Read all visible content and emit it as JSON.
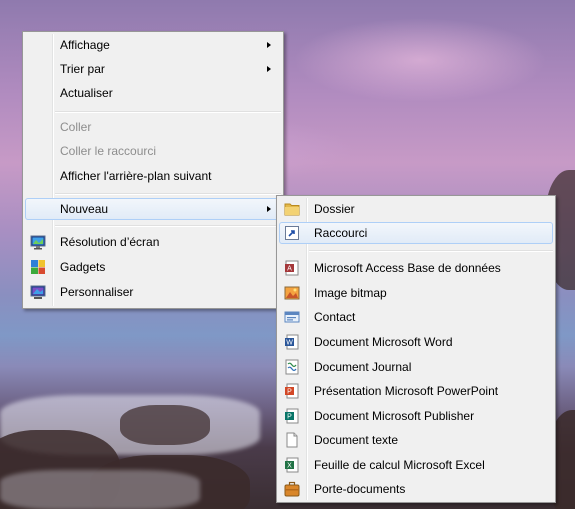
{
  "context_menu": {
    "items": [
      {
        "label": "Affichage",
        "submenu": true,
        "enabled": true
      },
      {
        "label": "Trier par",
        "submenu": true,
        "enabled": true
      },
      {
        "label": "Actualiser",
        "enabled": true
      },
      {
        "label": "Coller",
        "enabled": false
      },
      {
        "label": "Coller le raccourci",
        "enabled": false
      },
      {
        "label": "Afficher l'arrière-plan suivant",
        "enabled": true
      },
      {
        "label": "Nouveau",
        "submenu": true,
        "enabled": true,
        "highlighted": true
      },
      {
        "label": "Résolution d’écran",
        "icon": "monitor-icon"
      },
      {
        "label": "Gadgets",
        "icon": "gadgets-icon"
      },
      {
        "label": "Personnaliser",
        "icon": "personalize-icon"
      }
    ]
  },
  "new_submenu": {
    "items": [
      {
        "label": "Dossier",
        "icon": "folder-icon"
      },
      {
        "label": "Raccourci",
        "icon": "shortcut-icon",
        "highlighted": true
      },
      {
        "label": "Microsoft Access Base de données",
        "icon": "access-icon"
      },
      {
        "label": "Image bitmap",
        "icon": "bitmap-icon"
      },
      {
        "label": "Contact",
        "icon": "contact-icon"
      },
      {
        "label": "Document Microsoft Word",
        "icon": "word-icon"
      },
      {
        "label": "Document Journal",
        "icon": "journal-icon"
      },
      {
        "label": "Présentation Microsoft PowerPoint",
        "icon": "powerpoint-icon"
      },
      {
        "label": "Document Microsoft Publisher",
        "icon": "publisher-icon"
      },
      {
        "label": "Document texte",
        "icon": "text-document-icon"
      },
      {
        "label": "Feuille de calcul Microsoft Excel",
        "icon": "excel-icon"
      },
      {
        "label": "Porte-documents",
        "icon": "briefcase-icon"
      }
    ]
  },
  "colors": {
    "menu_background": "#f0f0f0",
    "menu_border": "#979797",
    "highlight_border": "#aecff7",
    "disabled_text": "#8d8d8d"
  }
}
